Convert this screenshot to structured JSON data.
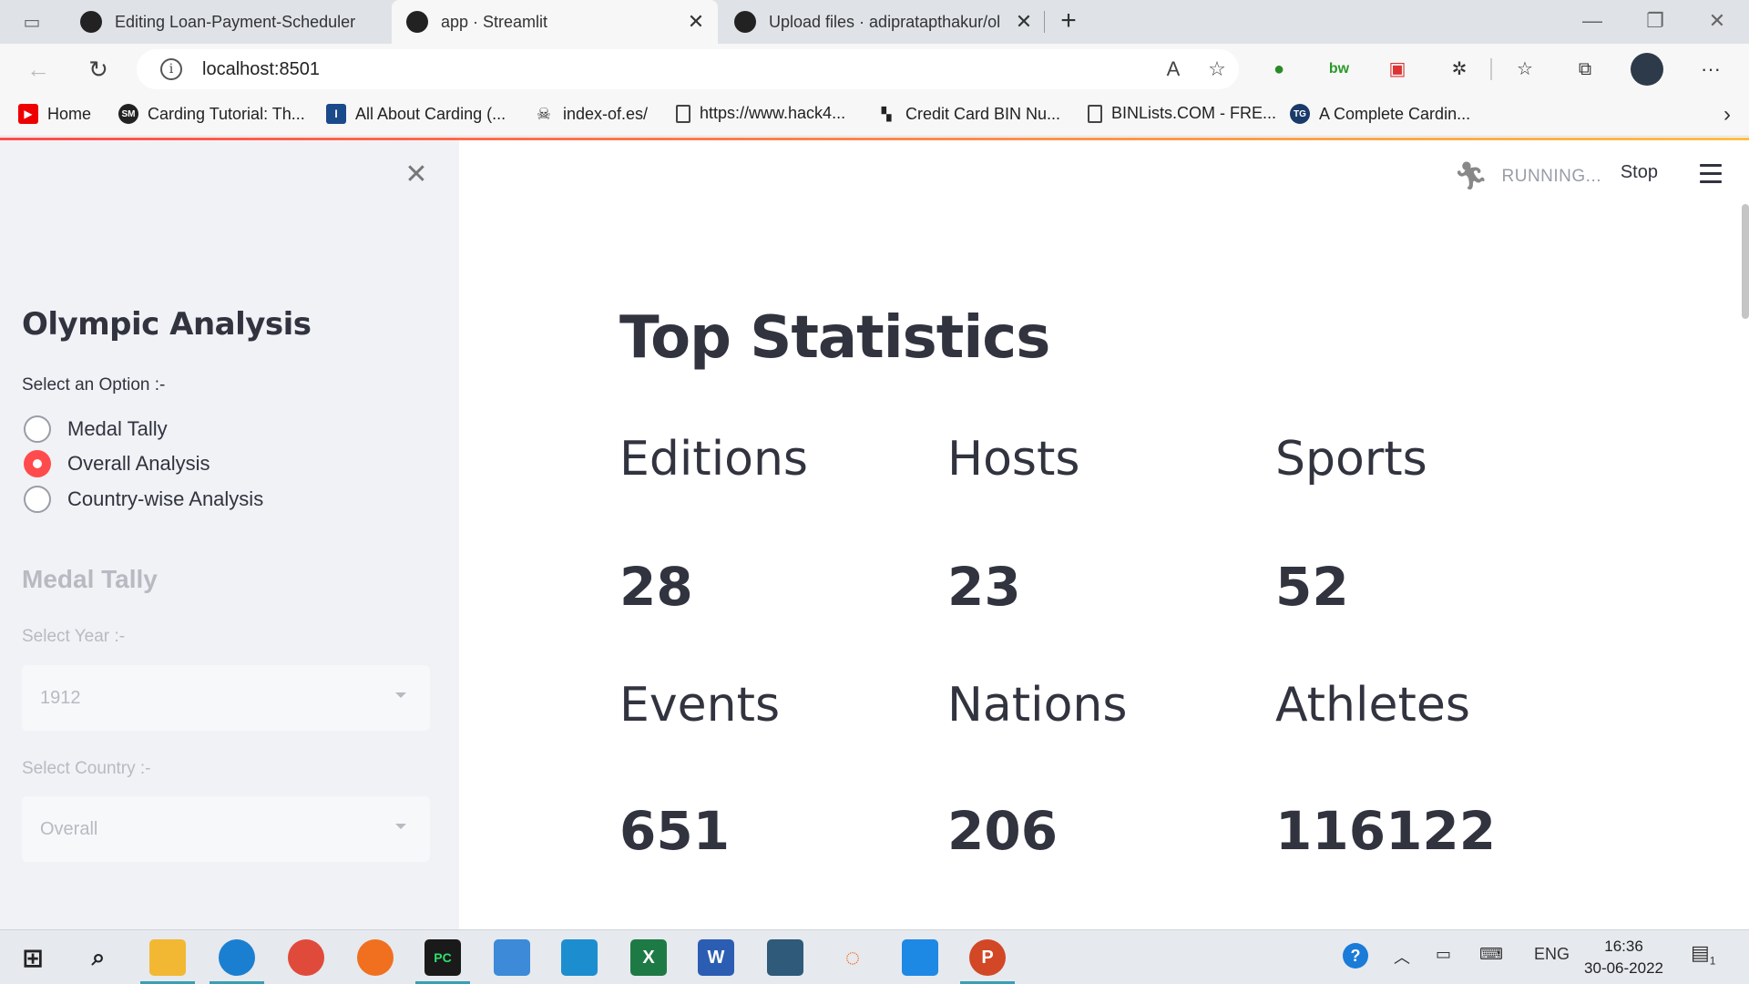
{
  "browser": {
    "tabs": [
      {
        "title": "Editing Loan-Payment-Scheduler",
        "icon": "github-icon",
        "active": false
      },
      {
        "title": "app · Streamlit",
        "icon": "streamlit-icon",
        "active": true
      },
      {
        "title": "Upload files · adipratapthakur/ol",
        "icon": "github-icon",
        "active": false
      }
    ],
    "new_tab": "+",
    "url": "localhost:8501",
    "bookmarks": [
      {
        "label": "Home",
        "icon": "youtube-icon"
      },
      {
        "label": "Carding Tutorial: Th...",
        "icon": "site-icon"
      },
      {
        "label": "All About Carding (...",
        "icon": "site-icon"
      },
      {
        "label": "index-of.es/",
        "icon": "skull-icon"
      },
      {
        "label": "https://www.hack4...",
        "icon": "page-icon"
      },
      {
        "label": "Credit Card BIN Nu...",
        "icon": "site-icon"
      },
      {
        "label": "BINLists.COM - FRE...",
        "icon": "page-icon"
      },
      {
        "label": "A Complete Cardin...",
        "icon": "site-icon"
      }
    ]
  },
  "app": {
    "status": "RUNNING...",
    "stop": "Stop",
    "sidebar": {
      "title": "Olympic Analysis",
      "option_label": "Select an Option :-",
      "options": [
        "Medal Tally",
        "Overall Analysis",
        "Country-wise Analysis"
      ],
      "selected_option": "Overall Analysis",
      "sub_title": "Medal Tally",
      "year_label": "Select Year :-",
      "year_value": "1912",
      "country_label": "Select Country :-",
      "country_value": "Overall"
    },
    "main": {
      "title": "Top Statistics",
      "stats": [
        {
          "label": "Editions",
          "value": "28"
        },
        {
          "label": "Hosts",
          "value": "23"
        },
        {
          "label": "Sports",
          "value": "52"
        },
        {
          "label": "Events",
          "value": "651"
        },
        {
          "label": "Nations",
          "value": "206"
        },
        {
          "label": "Athletes",
          "value": "116122"
        }
      ]
    }
  },
  "taskbar": {
    "language": "ENG",
    "time": "16:36",
    "date": "30-06-2022",
    "notification_count": "1"
  },
  "colors": {
    "accent": "#ff4b4b",
    "text": "#31333f",
    "sidebar_bg": "#f0f2f6"
  }
}
